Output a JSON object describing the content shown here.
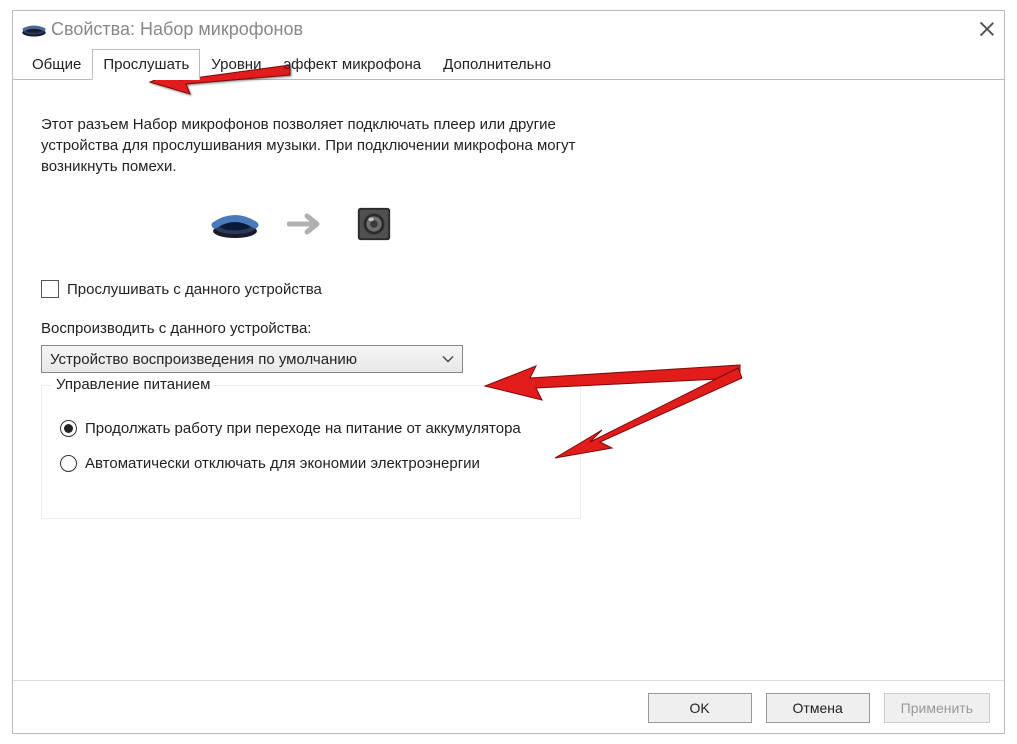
{
  "window": {
    "title": "Свойства: Набор микрофонов"
  },
  "tabs": [
    {
      "label": "Общие",
      "active": false
    },
    {
      "label": "Прослушать",
      "active": true
    },
    {
      "label": "Уровни",
      "active": false
    },
    {
      "label": "эффект микрофона",
      "active": false
    },
    {
      "label": "Дополнительно",
      "active": false
    }
  ],
  "description": "Этот разъем Набор микрофонов позволяет подключать плеер или другие устройства для прослушивания музыки. При подключении микрофона могут возникнуть помехи.",
  "listen_checkbox": {
    "label": "Прослушивать с данного устройства",
    "checked": false
  },
  "playback_label": "Воспроизводить с данного устройства:",
  "playback_device": "Устройство воспроизведения по умолчанию",
  "power": {
    "legend": "Управление питанием",
    "options": [
      {
        "label": "Продолжать работу при переходе на питание от аккумулятора",
        "selected": true
      },
      {
        "label": "Автоматически отключать для экономии электроэнергии",
        "selected": false
      }
    ]
  },
  "buttons": {
    "ok": "OK",
    "cancel": "Отмена",
    "apply": "Применить"
  },
  "icons": {
    "audio_device": "audio-jack-icon",
    "arrow_right": "arrow-right-icon",
    "speaker": "speaker-icon"
  }
}
